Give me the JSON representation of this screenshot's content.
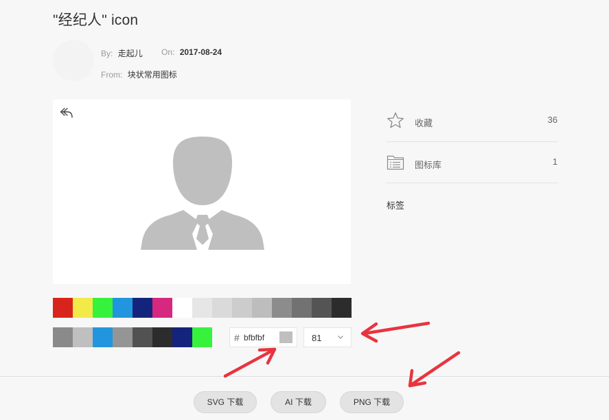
{
  "page": {
    "title": "\"经纪人\" icon"
  },
  "meta": {
    "by_label": "By:",
    "by_value": "走起儿",
    "on_label": "On:",
    "on_value": "2017-08-24",
    "from_label": "From:",
    "from_value": "块状常用图标"
  },
  "palette": {
    "row1": [
      "#d9241b",
      "#f2ea48",
      "#36f23d",
      "#2196de",
      "#14237c",
      "#d6287f",
      "#ffffff",
      "#e6e6e6",
      "#dadada",
      "#cccccc",
      "#bdbdbd",
      "#8c8c8c",
      "#727272",
      "#545454",
      "#2c2c2c"
    ],
    "row2": [
      "#8a8a8a",
      "#bfbfbf",
      "#2196de",
      "#959595",
      "#525252",
      "#2c2c2c",
      "#14237c",
      "#36f23d"
    ]
  },
  "color_input": {
    "hash": "#",
    "value": "bfbfbf",
    "chip_color": "#bfbfbf"
  },
  "size_select": {
    "value": "81"
  },
  "sidebar": {
    "favorites_label": "收藏",
    "favorites_count": "36",
    "library_label": "图标库",
    "library_count": "1",
    "tags_label": "标签"
  },
  "downloads": {
    "svg_label": "SVG 下载",
    "ai_label": "AI 下载",
    "png_label": "PNG 下载"
  },
  "colors": {
    "icon_gray": "#bfbfbf",
    "arrow_red": "#e8343f"
  }
}
